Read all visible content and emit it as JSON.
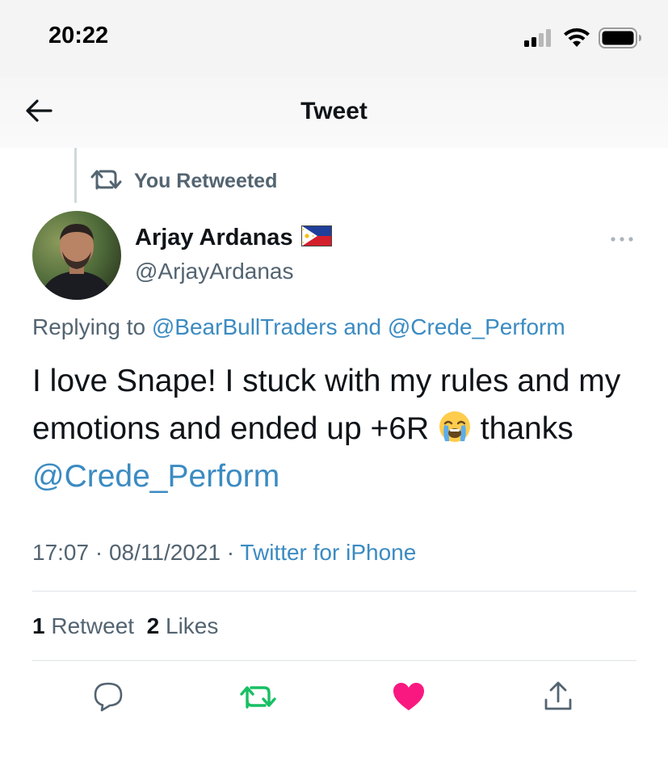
{
  "status_bar": {
    "time": "20:22",
    "icons": [
      "cellular-signal-icon",
      "wifi-icon",
      "battery-icon"
    ]
  },
  "header": {
    "title": "Tweet",
    "back_icon": "back-arrow-icon"
  },
  "retweet_context": {
    "icon": "retweet-icon",
    "label": "You Retweeted"
  },
  "author": {
    "name": "Arjay Ardanas",
    "flag_icon": "philippines-flag-icon",
    "handle": "@ArjayArdanas",
    "avatar_icon": "avatar"
  },
  "reply": {
    "prefix": "Replying to ",
    "mention_1": "@BearBullTraders",
    "joiner": " and ",
    "mention_2": "@Crede_Perform"
  },
  "tweet": {
    "text_part_1": "I love Snape! I stuck with my rules and my emotions and ended up +6R ",
    "emoji": "loudly-crying-face-icon",
    "text_part_2": " thanks ",
    "mention": "@Crede_Perform"
  },
  "meta": {
    "time": "17:07",
    "separator": " · ",
    "date": "08/11/2021",
    "separator_2": " · ",
    "source": "Twitter for iPhone"
  },
  "stats": {
    "retweets_count": "1",
    "retweets_label": "Retweet",
    "likes_count": "2",
    "likes_label": "Likes"
  },
  "actions": {
    "reply_icon": "reply-icon",
    "retweet_icon": "retweet-icon",
    "like_icon": "heart-icon",
    "share_icon": "share-icon",
    "retweet_active_color": "#17bf63",
    "like_active_color": "#f91880"
  },
  "colors": {
    "link": "#3b8bc2",
    "secondary_text": "#536471",
    "primary_text": "#0f1419"
  }
}
